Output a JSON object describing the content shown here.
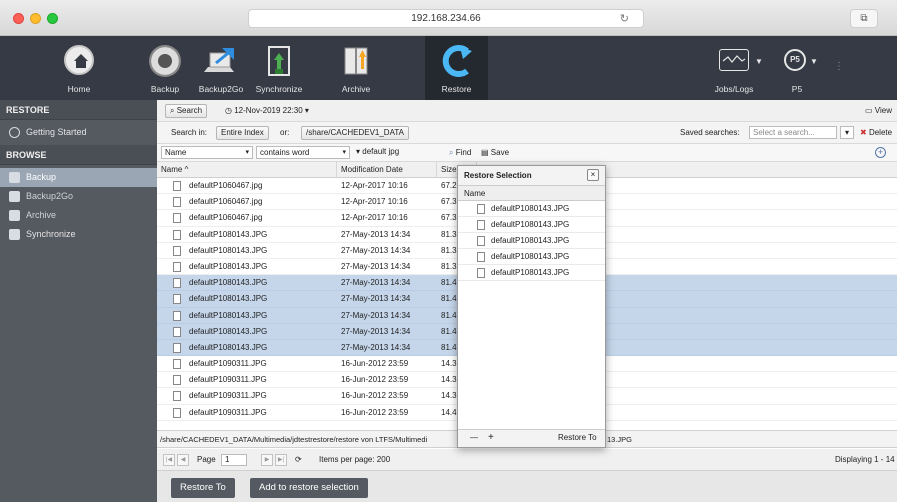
{
  "browser": {
    "url": "192.168.234.66"
  },
  "toolbar": {
    "items": [
      {
        "label": "Home",
        "icon": "home-icon"
      },
      {
        "label": "Backup",
        "icon": "gauge-icon"
      },
      {
        "label": "Backup2Go",
        "icon": "laptop-upload-icon"
      },
      {
        "label": "Synchronize",
        "icon": "sync-door-icon"
      },
      {
        "label": "Archive",
        "icon": "archive-icon"
      },
      {
        "label": "Restore",
        "icon": "restore-arrow-icon"
      }
    ],
    "right": [
      {
        "label": "Jobs/Logs",
        "icon": "chart-window-icon"
      },
      {
        "label": "P5",
        "icon": "p5-logo-icon"
      }
    ]
  },
  "sidebar": {
    "sections": [
      {
        "title": "RESTORE",
        "items": [
          {
            "label": "Getting Started",
            "icon": "getting-started-icon"
          }
        ]
      },
      {
        "title": "BROWSE",
        "items": [
          {
            "label": "Backup",
            "icon": "backup-icon"
          },
          {
            "label": "Backup2Go",
            "icon": "backup2go-icon"
          },
          {
            "label": "Archive",
            "icon": "archive-small-icon"
          },
          {
            "label": "Synchronize",
            "icon": "synchronize-icon"
          }
        ]
      }
    ]
  },
  "searchbar": {
    "search_label": "Search",
    "date_label": "12-Nov-2019 22:30 ▾",
    "view_label": "View"
  },
  "searchin": {
    "label": "Search in:",
    "index_label": "Entire Index",
    "or_label": "or:",
    "path": "/share/CACHEDEV1_DATA",
    "saved_label": "Saved searches:",
    "saved_placeholder": "Select a search...",
    "delete_label": "Delete"
  },
  "filter": {
    "field": "Name",
    "op": "contains word",
    "value": "default jpg",
    "find_label": "Find",
    "save_label": "Save"
  },
  "table": {
    "columns": [
      "Name ^",
      "Modification Date",
      "Size"
    ],
    "rows": [
      {
        "name": "defaultP1060467.jpg",
        "date": "12-Apr-2017 10:16",
        "size": "67.2",
        "selected": false
      },
      {
        "name": "defaultP1060467.jpg",
        "date": "12-Apr-2017 10:16",
        "size": "67.3",
        "selected": false
      },
      {
        "name": "defaultP1060467.jpg",
        "date": "12-Apr-2017 10:16",
        "size": "67.3",
        "selected": false
      },
      {
        "name": "defaultP1080143.JPG",
        "date": "27-May-2013 14:34",
        "size": "81.3",
        "selected": false
      },
      {
        "name": "defaultP1080143.JPG",
        "date": "27-May-2013 14:34",
        "size": "81.3",
        "selected": false
      },
      {
        "name": "defaultP1080143.JPG",
        "date": "27-May-2013 14:34",
        "size": "81.3",
        "selected": false
      },
      {
        "name": "defaultP1080143.JPG",
        "date": "27-May-2013 14:34",
        "size": "81.4",
        "selected": true
      },
      {
        "name": "defaultP1080143.JPG",
        "date": "27-May-2013 14:34",
        "size": "81.4",
        "selected": true
      },
      {
        "name": "defaultP1080143.JPG",
        "date": "27-May-2013 14:34",
        "size": "81.4",
        "selected": true
      },
      {
        "name": "defaultP1080143.JPG",
        "date": "27-May-2013 14:34",
        "size": "81.4",
        "selected": true
      },
      {
        "name": "defaultP1080143.JPG",
        "date": "27-May-2013 14:34",
        "size": "81.4",
        "selected": true
      },
      {
        "name": "defaultP1090311.JPG",
        "date": "16-Jun-2012 23:59",
        "size": "14.3",
        "selected": false
      },
      {
        "name": "defaultP1090311.JPG",
        "date": "16-Jun-2012 23:59",
        "size": "14.3",
        "selected": false
      },
      {
        "name": "defaultP1090311.JPG",
        "date": "16-Jun-2012 23:59",
        "size": "14.3",
        "selected": false
      },
      {
        "name": "defaultP1090311.JPG",
        "date": "16-Jun-2012 23:59",
        "size": "14.4",
        "selected": false
      }
    ]
  },
  "path": {
    "text_left": "/share/CACHEDEV1_DATA/Multimedia/jdtestrestore/restore von LTFS/Multimedi",
    "text_right": "13.JPG"
  },
  "pager": {
    "page_label": "Page",
    "page_value": "1",
    "items_per_page": "Items per page: 200",
    "displaying": "Displaying 1 - 14"
  },
  "footer": {
    "restore_to": "Restore To",
    "add_to_selection": "Add to restore selection"
  },
  "popup": {
    "title": "Restore Selection",
    "column": "Name",
    "items": [
      "defaultP1080143.JPG",
      "defaultP1080143.JPG",
      "defaultP1080143.JPG",
      "defaultP1080143.JPG",
      "defaultP1080143.JPG"
    ],
    "remove": "—",
    "add": "+",
    "restore_to": "Restore To"
  },
  "colors": {
    "toolbar_bg": "#353a45",
    "sidebar_bg": "#555960",
    "selected_row": "#c5d6ea",
    "active_sidebar": "#9aa6b4"
  }
}
